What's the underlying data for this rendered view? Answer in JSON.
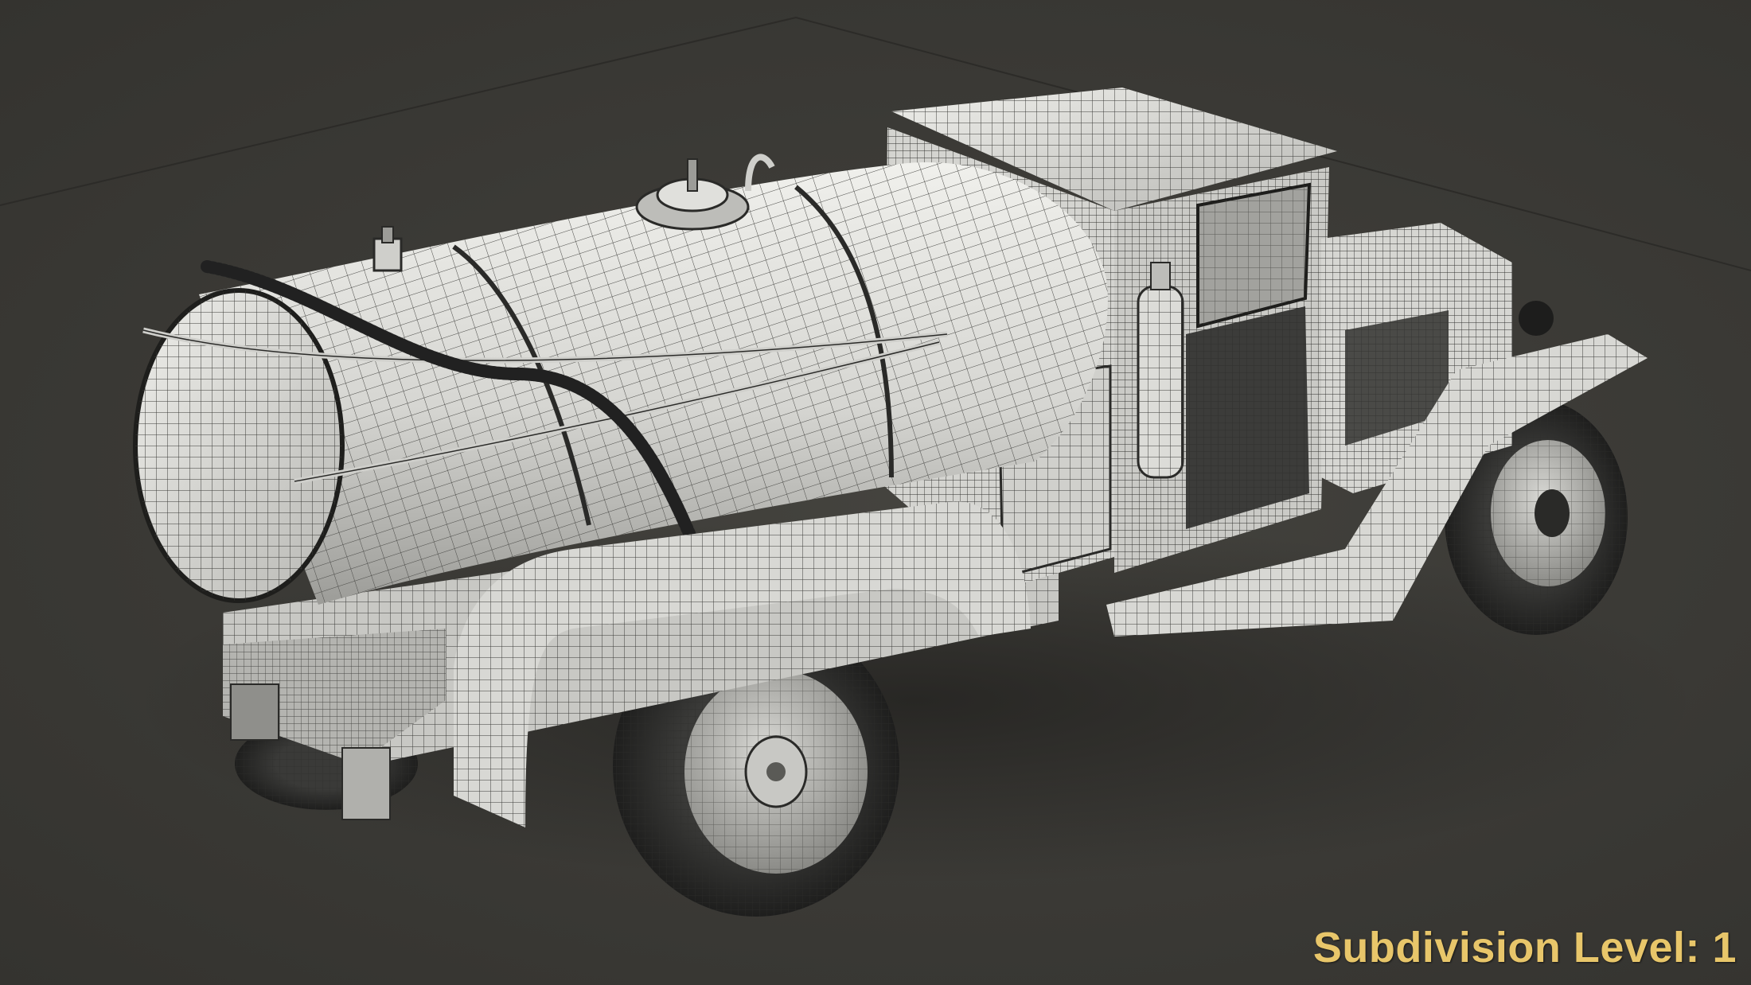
{
  "caption": {
    "text": "Subdivision Level: 1",
    "color": "#e8c66a"
  },
  "render": {
    "subject": "tanker-truck-wireframe",
    "background_color": "#3c3b37",
    "surface_color": "#d8d8d4",
    "wire_color": "#2a2a28",
    "tire_color": "#2b2b29"
  }
}
